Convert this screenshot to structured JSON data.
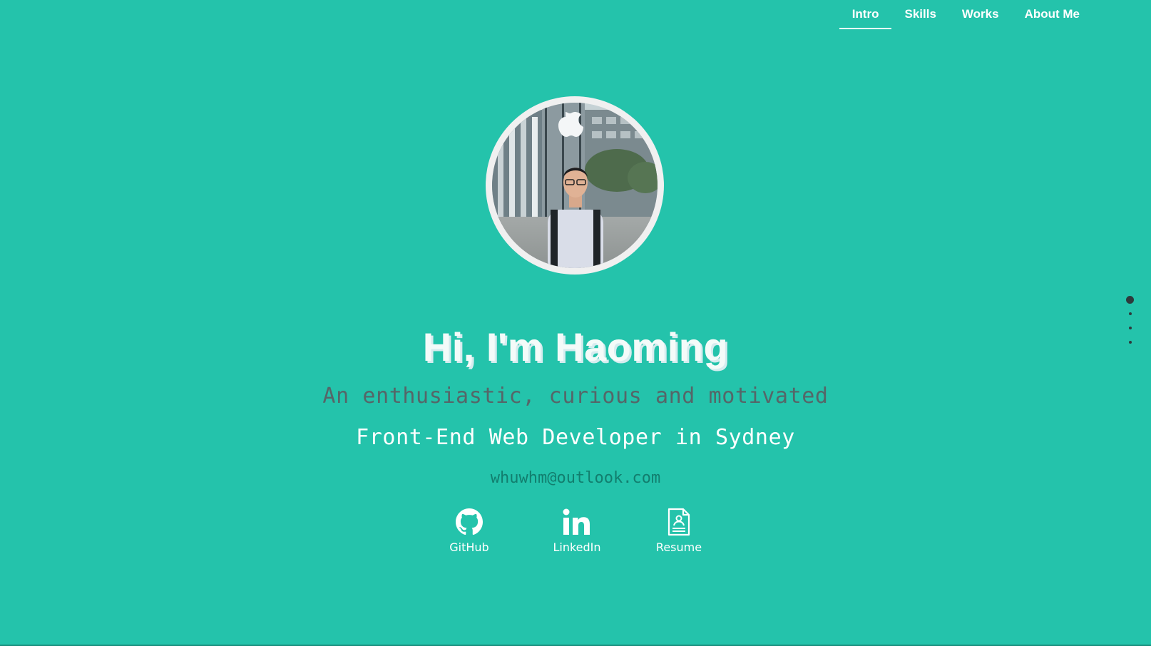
{
  "nav": {
    "items": [
      {
        "label": "Intro",
        "active": true
      },
      {
        "label": "Skills",
        "active": false
      },
      {
        "label": "Works",
        "active": false
      },
      {
        "label": "About Me",
        "active": false
      }
    ]
  },
  "hero": {
    "title": "Hi, I'm Haoming",
    "subtitle": "An enthusiastic, curious and motivated",
    "role": "Front-End Web Developer in Sydney",
    "email": "whuwhm@outlook.com"
  },
  "links": [
    {
      "label": "GitHub",
      "icon": "github-icon"
    },
    {
      "label": "LinkedIn",
      "icon": "linkedin-icon"
    },
    {
      "label": "Resume",
      "icon": "document-icon"
    }
  ],
  "side_nav": {
    "active_index": 0,
    "count": 4
  },
  "colors": {
    "background": "#24c3ab",
    "text_light": "#ffffff",
    "subtitle": "#556668",
    "email": "#127e6e",
    "dot": "#2e3a3c"
  }
}
